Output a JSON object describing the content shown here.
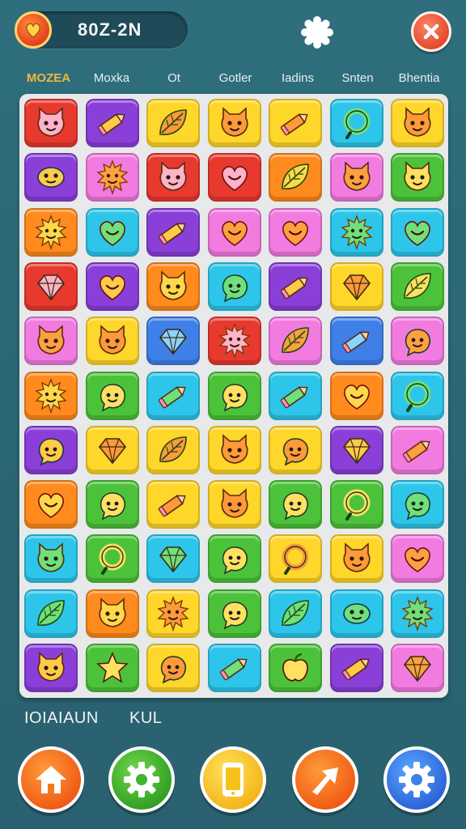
{
  "header": {
    "score_text": "80Z-2N",
    "score_icon": "heart-coin-icon",
    "settings_icon": "gear-icon",
    "close_icon": "close-icon"
  },
  "categories": [
    "MOZEA",
    "Moxka",
    "Ot",
    "Gotler",
    "Iadins",
    "Snten",
    "Bhentia"
  ],
  "board": {
    "columns": 7,
    "rows": 11,
    "tiles": [
      [
        "red",
        "cat"
      ],
      [
        "purple",
        "pencil"
      ],
      [
        "yellow",
        "leaf"
      ],
      [
        "yellow",
        "cat"
      ],
      [
        "yellow",
        "pencil"
      ],
      [
        "cyan",
        "ring"
      ],
      [
        "yellow",
        "cat"
      ],
      [
        "purple",
        "fish"
      ],
      [
        "pink",
        "sun"
      ],
      [
        "red",
        "cat"
      ],
      [
        "red",
        "heart"
      ],
      [
        "orange",
        "leaf"
      ],
      [
        "pink",
        "cat"
      ],
      [
        "green",
        "cat"
      ],
      [
        "orange",
        "sun"
      ],
      [
        "cyan",
        "heart"
      ],
      [
        "purple",
        "pencil"
      ],
      [
        "pink",
        "heart"
      ],
      [
        "pink",
        "heart"
      ],
      [
        "cyan",
        "sun"
      ],
      [
        "cyan",
        "heart"
      ],
      [
        "red",
        "gem"
      ],
      [
        "purple",
        "heart"
      ],
      [
        "orange",
        "cat"
      ],
      [
        "cyan",
        "blob"
      ],
      [
        "purple",
        "pencil"
      ],
      [
        "yellow",
        "gem"
      ],
      [
        "green",
        "leaf"
      ],
      [
        "pink",
        "cat"
      ],
      [
        "yellow",
        "cat"
      ],
      [
        "blue",
        "gem"
      ],
      [
        "red",
        "sun"
      ],
      [
        "pink",
        "leaf"
      ],
      [
        "blue",
        "pencil"
      ],
      [
        "pink",
        "blob"
      ],
      [
        "orange",
        "sun"
      ],
      [
        "green",
        "blob"
      ],
      [
        "cyan",
        "pencil"
      ],
      [
        "green",
        "blob"
      ],
      [
        "cyan",
        "pencil"
      ],
      [
        "orange",
        "heart"
      ],
      [
        "cyan",
        "ring"
      ],
      [
        "purple",
        "blob"
      ],
      [
        "yellow",
        "gem"
      ],
      [
        "yellow",
        "leaf"
      ],
      [
        "yellow",
        "cat"
      ],
      [
        "yellow",
        "blob"
      ],
      [
        "purple",
        "gem"
      ],
      [
        "pink",
        "pencil"
      ],
      [
        "orange",
        "heart"
      ],
      [
        "green",
        "blob"
      ],
      [
        "yellow",
        "pencil"
      ],
      [
        "yellow",
        "cat"
      ],
      [
        "green",
        "blob"
      ],
      [
        "green",
        "ring"
      ],
      [
        "cyan",
        "blob"
      ],
      [
        "cyan",
        "cat"
      ],
      [
        "green",
        "ring"
      ],
      [
        "cyan",
        "gem"
      ],
      [
        "green",
        "blob"
      ],
      [
        "yellow",
        "ring"
      ],
      [
        "yellow",
        "cat"
      ],
      [
        "pink",
        "heart"
      ],
      [
        "cyan",
        "leaf"
      ],
      [
        "orange",
        "cat"
      ],
      [
        "yellow",
        "sun"
      ],
      [
        "green",
        "blob"
      ],
      [
        "cyan",
        "leaf"
      ],
      [
        "cyan",
        "fish"
      ],
      [
        "cyan",
        "sun"
      ],
      [
        "purple",
        "cat"
      ],
      [
        "green",
        "star"
      ],
      [
        "yellow",
        "blob"
      ],
      [
        "cyan",
        "pencil"
      ],
      [
        "green",
        "apple"
      ],
      [
        "purple",
        "pencil"
      ],
      [
        "pink",
        "gem"
      ]
    ]
  },
  "bottom_labels": {
    "left": "IOIAIAUN",
    "right": "KUL"
  },
  "bottom_buttons": [
    {
      "icon": "home-icon",
      "color": "orange"
    },
    {
      "icon": "gear-icon",
      "color": "green"
    },
    {
      "icon": "phone-icon",
      "color": "yellow"
    },
    {
      "icon": "share-arrow-icon",
      "color": "orange"
    },
    {
      "icon": "gear-icon",
      "color": "blue"
    }
  ],
  "colors": {
    "background": "#2b6674",
    "board": "#e7e9ea",
    "red": "#e8392f",
    "purple": "#8a3fd8",
    "yellow": "#ffd62a",
    "orange": "#ff8a1e",
    "cyan": "#2dc6ea",
    "pink": "#f27be0",
    "green": "#4cc23a",
    "blue": "#3f7fe8"
  }
}
